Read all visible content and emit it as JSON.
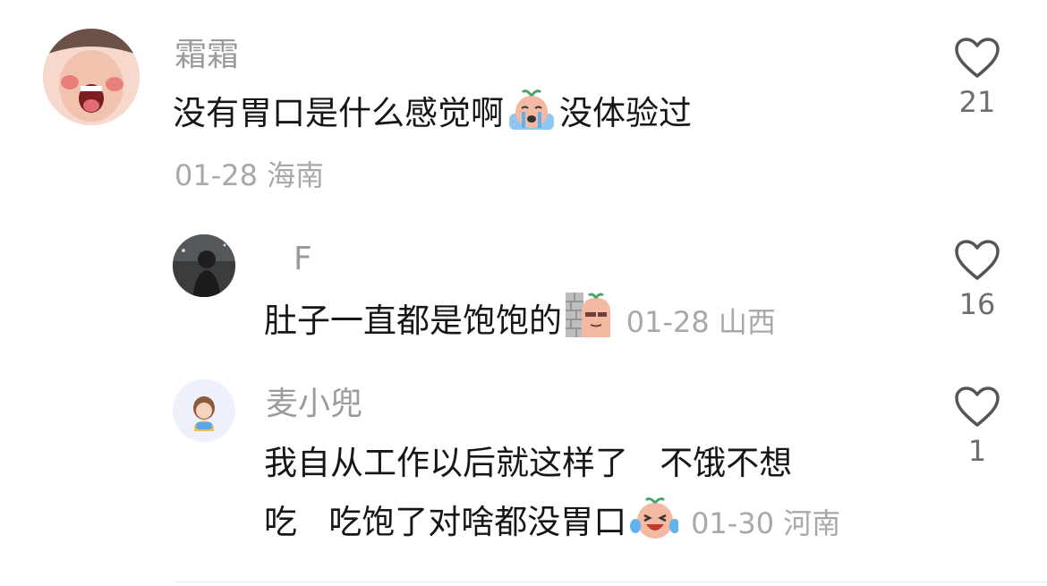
{
  "comments": [
    {
      "username": "霜霜",
      "text_a": "没有胃口是什么感觉啊",
      "emoji": "crying-face-emoji",
      "text_b": "没体验过",
      "date": "01-28",
      "location": "海南",
      "likes": "21"
    },
    {
      "username": "F",
      "text": "肚子一直都是饱饱的",
      "emoji": "peeking-behind-wall-emoji",
      "date": "01-28",
      "location": "山西",
      "likes": "16"
    },
    {
      "username": "麦小兜",
      "line1": "我自从工作以后就这样了   不饿不想",
      "line2": "吃   吃饱了对啥都没胃口",
      "emoji": "laugh-crying-emoji",
      "date": "01-30",
      "location": "河南",
      "likes": "1"
    }
  ]
}
